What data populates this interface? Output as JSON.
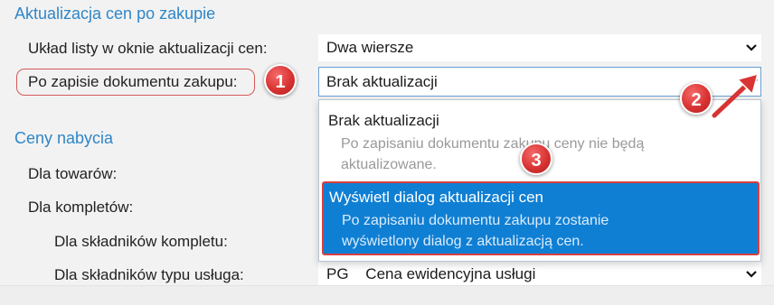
{
  "section_purchase": {
    "title": "Aktualizacja cen po zakupie",
    "list_layout_label": "Układ listy w oknie aktualizacji cen:",
    "list_layout_value": "Dwa wiersze",
    "after_save_label": "Po zapisie dokumentu zakupu:",
    "after_save_value": "Brak aktualizacji"
  },
  "dropdown_options": [
    {
      "title": "Brak aktualizacji",
      "desc_line1": "Po zapisaniu dokumentu zakupu ceny nie będą",
      "desc_line2": "aktualizowane."
    },
    {
      "title": "Wyświetl dialog aktualizacji cen",
      "desc_line1": "Po zapisaniu dokumentu zakupu zostanie",
      "desc_line2": "wyświetlony dialog z aktualizacją cen."
    }
  ],
  "section_prices": {
    "title": "Ceny nabycia",
    "goods_label": "Dla towarów:",
    "sets_label": "Dla kompletów:",
    "set_components_label": "Dla składników kompletu:",
    "service_components_label": "Dla składników typu usługa:",
    "service_code": "PG",
    "service_value": "Cena ewidencyjna usługi"
  },
  "annotations": {
    "badge1": "1",
    "badge2": "2",
    "badge3": "3"
  },
  "colors": {
    "accent_blue": "#2f86c8",
    "selected_bg": "#0f7fd4",
    "annotation_red": "#d93333"
  }
}
